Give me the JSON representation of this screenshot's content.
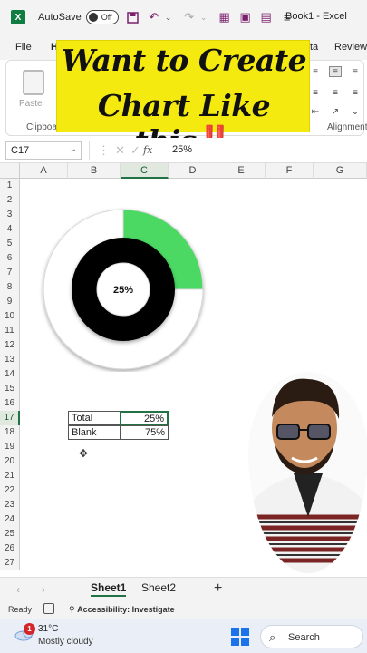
{
  "titlebar": {
    "app_logo": "X",
    "autosave_label": "AutoSave",
    "autosave_state": "Off",
    "doc_title": "Book1 - Excel",
    "icons": [
      "save-icon",
      "undo-icon",
      "redo-icon",
      "form-icon",
      "macro-icon",
      "clear-icon",
      "more-icon"
    ]
  },
  "ribbon": {
    "tabs": [
      {
        "label": "File"
      },
      {
        "label": "H"
      },
      {
        "label": "ta"
      },
      {
        "label": "Review"
      }
    ],
    "paste_label": "Paste",
    "clipboard_label": "Clipboard",
    "alignment_label": "Alignment"
  },
  "banner": {
    "line1": "Want to Create",
    "line2": "Chart Like this",
    "emphasis": "‼️"
  },
  "formula_bar": {
    "name_box": "C17",
    "fx": "fx",
    "value": "25%"
  },
  "grid": {
    "columns": [
      "A",
      "B",
      "C",
      "D",
      "E",
      "F",
      "G"
    ],
    "selected_column": "C",
    "rows": [
      "1",
      "2",
      "3",
      "4",
      "5",
      "6",
      "7",
      "8",
      "9",
      "10",
      "11",
      "12",
      "13",
      "14",
      "15",
      "16",
      "17",
      "18",
      "19",
      "20",
      "21",
      "22",
      "23",
      "24",
      "25",
      "26",
      "27"
    ],
    "selected_row": "17"
  },
  "chart_data": {
    "type": "pie",
    "categories": [
      "Total Profit",
      "Blank"
    ],
    "values": [
      25,
      75
    ],
    "center_label": "25%",
    "colors": {
      "profit": "#4cd964",
      "blank": "#ffffff",
      "inner_ring": "#000000"
    }
  },
  "table": {
    "rows": [
      {
        "label": "Total Profit",
        "value": "25%"
      },
      {
        "label": "Blank",
        "value": "75%"
      }
    ]
  },
  "sheets": {
    "tabs": [
      {
        "label": "Sheet1",
        "active": true
      },
      {
        "label": "Sheet2",
        "active": false
      }
    ],
    "add": "+"
  },
  "status": {
    "ready": "Ready",
    "accessibility": "Accessibility: Investigate"
  },
  "taskbar": {
    "weather_badge": "1",
    "temp": "31°C",
    "desc": "Mostly cloudy",
    "search_label": "Search"
  },
  "colors": {
    "accent": "#217346",
    "banner": "#f5ea10"
  }
}
